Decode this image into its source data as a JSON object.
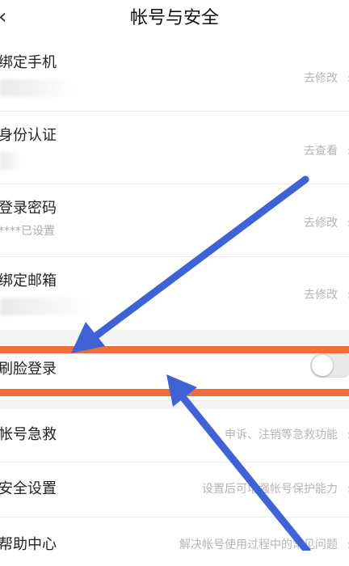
{
  "header": {
    "title": "帐号与安全",
    "back_icon": "chevron-left-icon"
  },
  "rows": [
    {
      "label": "绑定手机",
      "action": "去修改"
    },
    {
      "label": "身份认证",
      "action": "去查看"
    },
    {
      "label": "登录密码",
      "sub": "****已设置",
      "action": "去修改"
    },
    {
      "label": "绑定邮箱",
      "action": "去修改"
    }
  ],
  "face_login": {
    "label": "刷脸登录",
    "enabled": false
  },
  "rows2": [
    {
      "label": "帐号急救",
      "action": "申诉、注销等急救功能"
    },
    {
      "label": "安全设置",
      "action": "设置后可增强帐号保护能力"
    },
    {
      "label": "帮助中心",
      "action": "解决帐号使用过程中的常见问题"
    }
  ],
  "chevron": "›",
  "colors": {
    "highlight": "#f26d3d",
    "arrow": "#3f63d6"
  }
}
